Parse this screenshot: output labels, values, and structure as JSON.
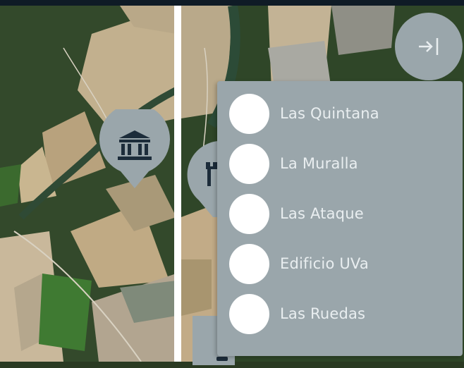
{
  "map": {
    "base": "satellite",
    "colors": {
      "forest": "#2c4527",
      "field_light": "#c8b597",
      "field_mid": "#a99978",
      "field_green": "#3f7a32",
      "river": "#2f4a35"
    }
  },
  "markers": [
    {
      "icon": "museum-icon"
    },
    {
      "icon": "castle-icon"
    },
    {
      "icon": "place-icon"
    }
  ],
  "panel": {
    "exit_icon": "arrow-right-to-bar-icon",
    "items": [
      {
        "label": "Las Quintana"
      },
      {
        "label": "La Muralla"
      },
      {
        "label": "Las Ataque"
      },
      {
        "label": "Edificio UVa"
      },
      {
        "label": "Las Ruedas"
      }
    ]
  },
  "theme": {
    "panel_bg": "#9aa6ab",
    "panel_text": "#e9eef0",
    "dot": "#ffffff",
    "topbar": "#0f1b26"
  }
}
